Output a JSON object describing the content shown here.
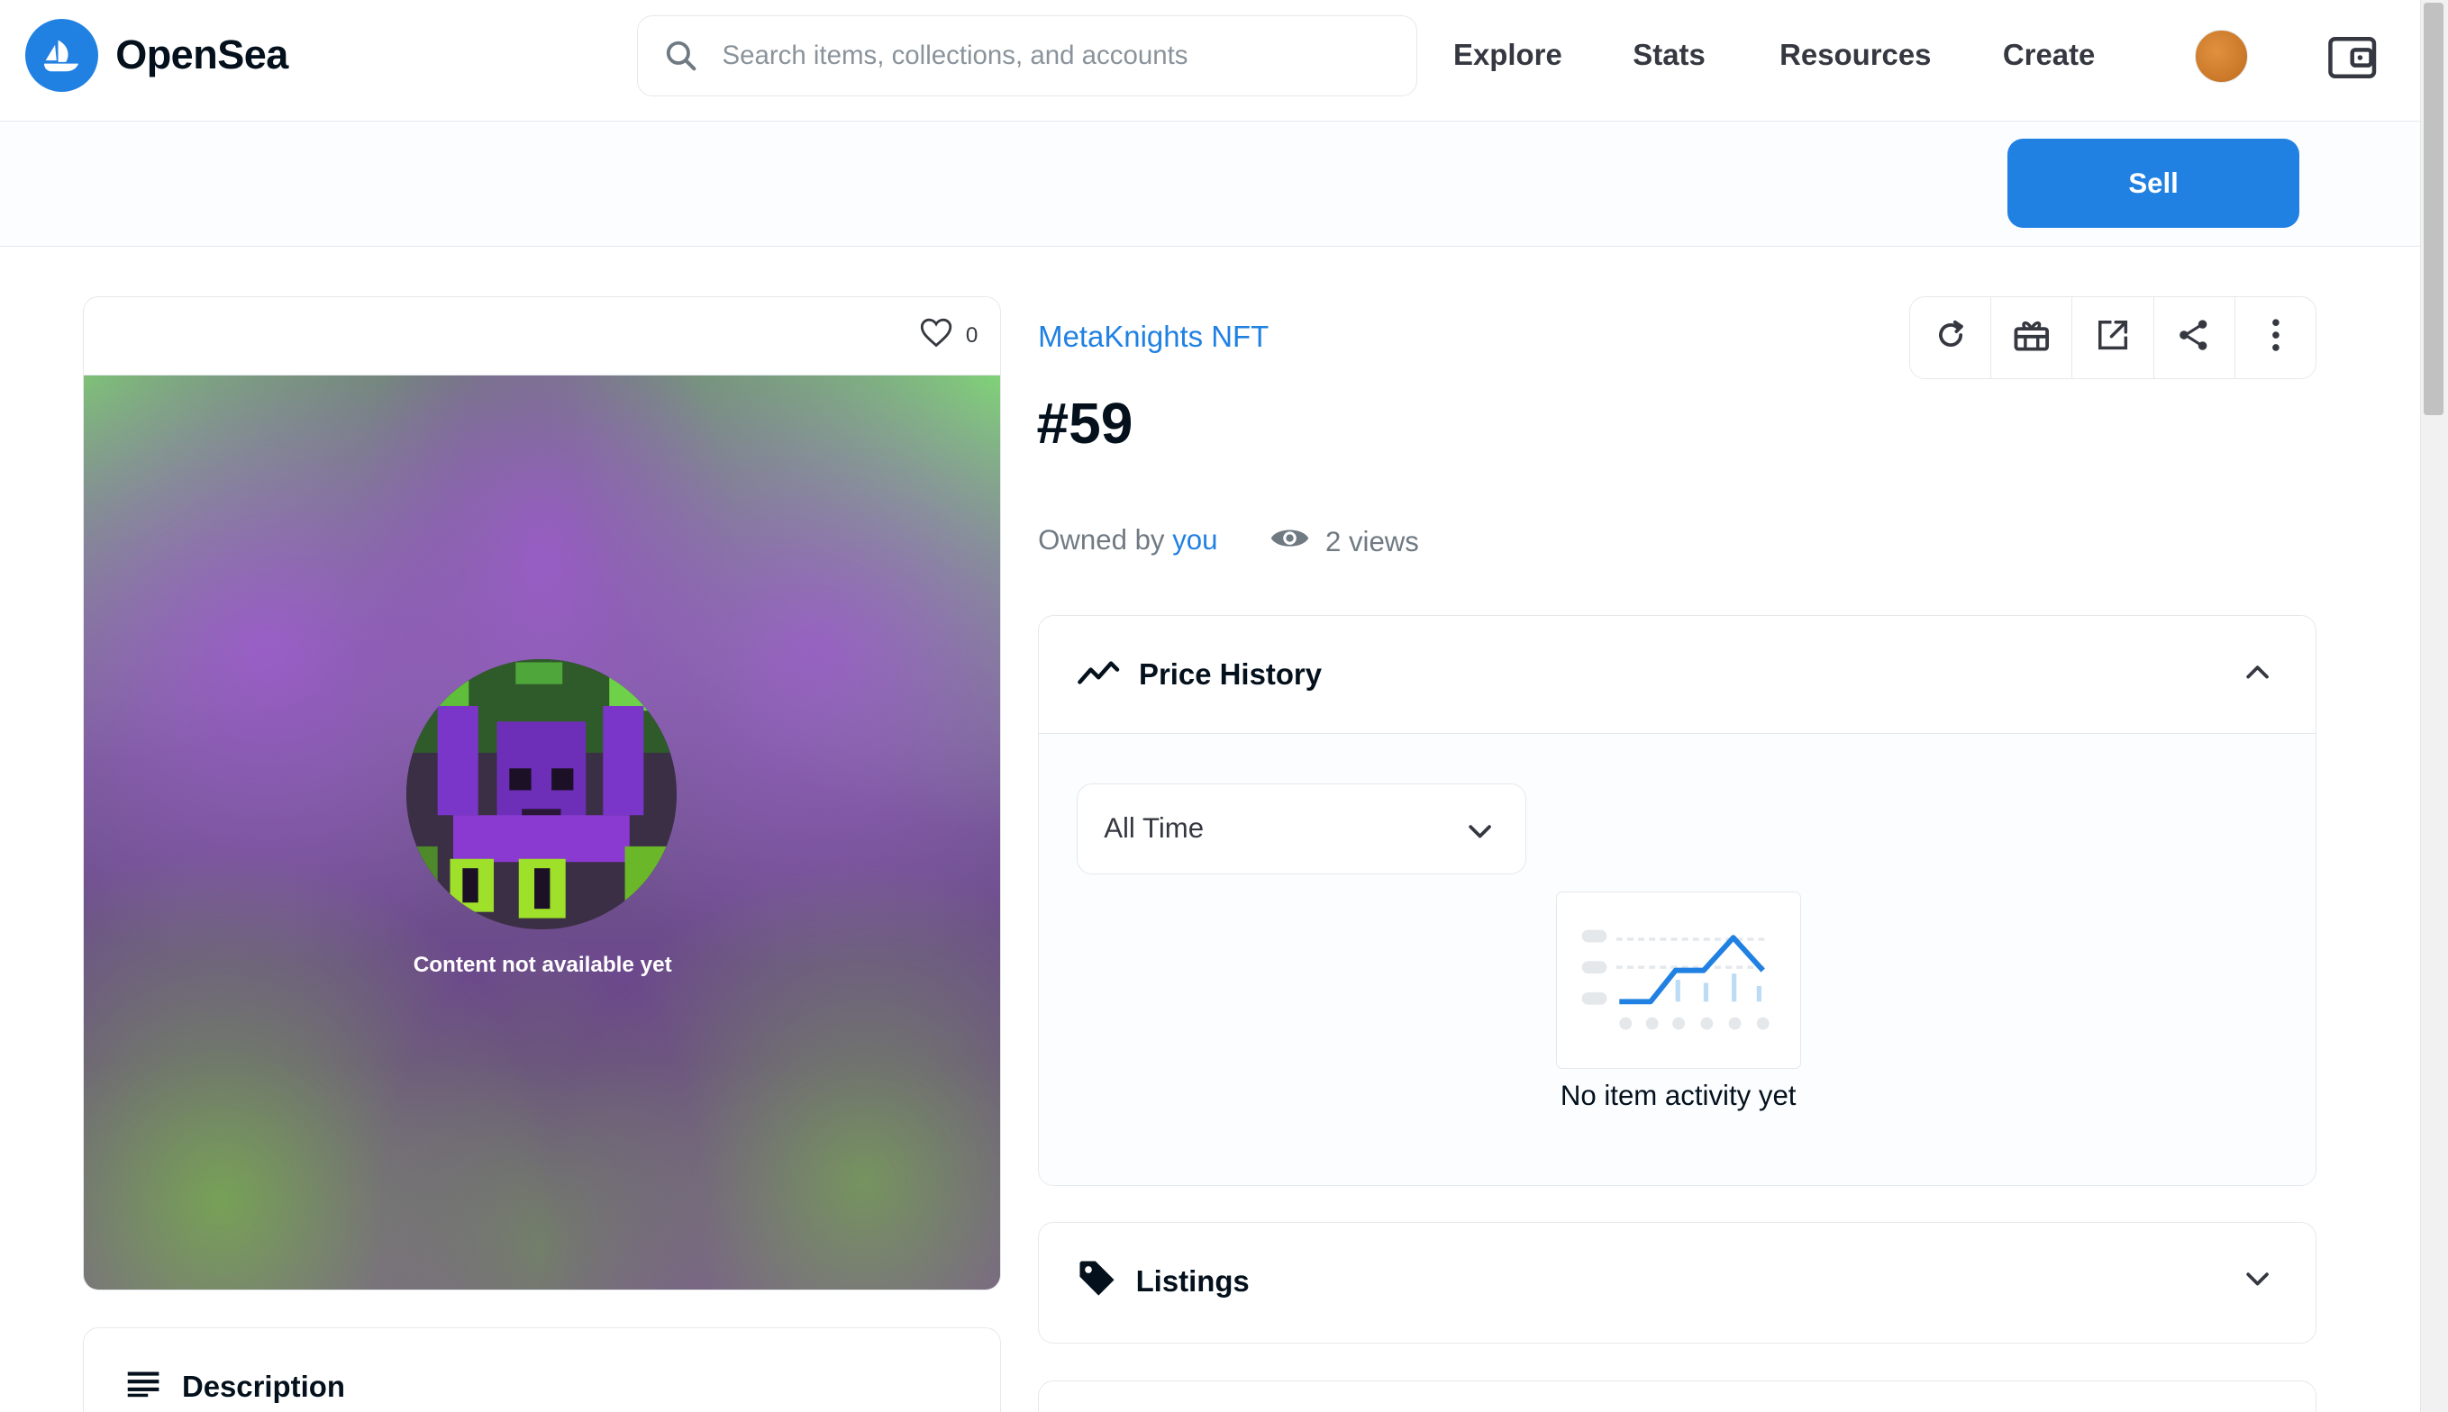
{
  "header": {
    "brand": "OpenSea",
    "search_placeholder": "Search items, collections, and accounts",
    "nav": [
      "Explore",
      "Stats",
      "Resources",
      "Create"
    ]
  },
  "sell_bar": {
    "sell_label": "Sell"
  },
  "media": {
    "favorite_count": "0",
    "content_note": "Content not available yet"
  },
  "description": {
    "title": "Description"
  },
  "item": {
    "collection": "MetaKnights NFT",
    "title": "#59",
    "owned_by_label": "Owned by",
    "owner": "you",
    "views": "2 views"
  },
  "price_history": {
    "title": "Price History",
    "range_selected": "All Time",
    "empty_text": "No item activity yet"
  },
  "listings": {
    "title": "Listings"
  },
  "colors": {
    "accent": "#2081e2",
    "border": "#e5e8eb",
    "text": "#04111d",
    "muted": "#707a83"
  }
}
